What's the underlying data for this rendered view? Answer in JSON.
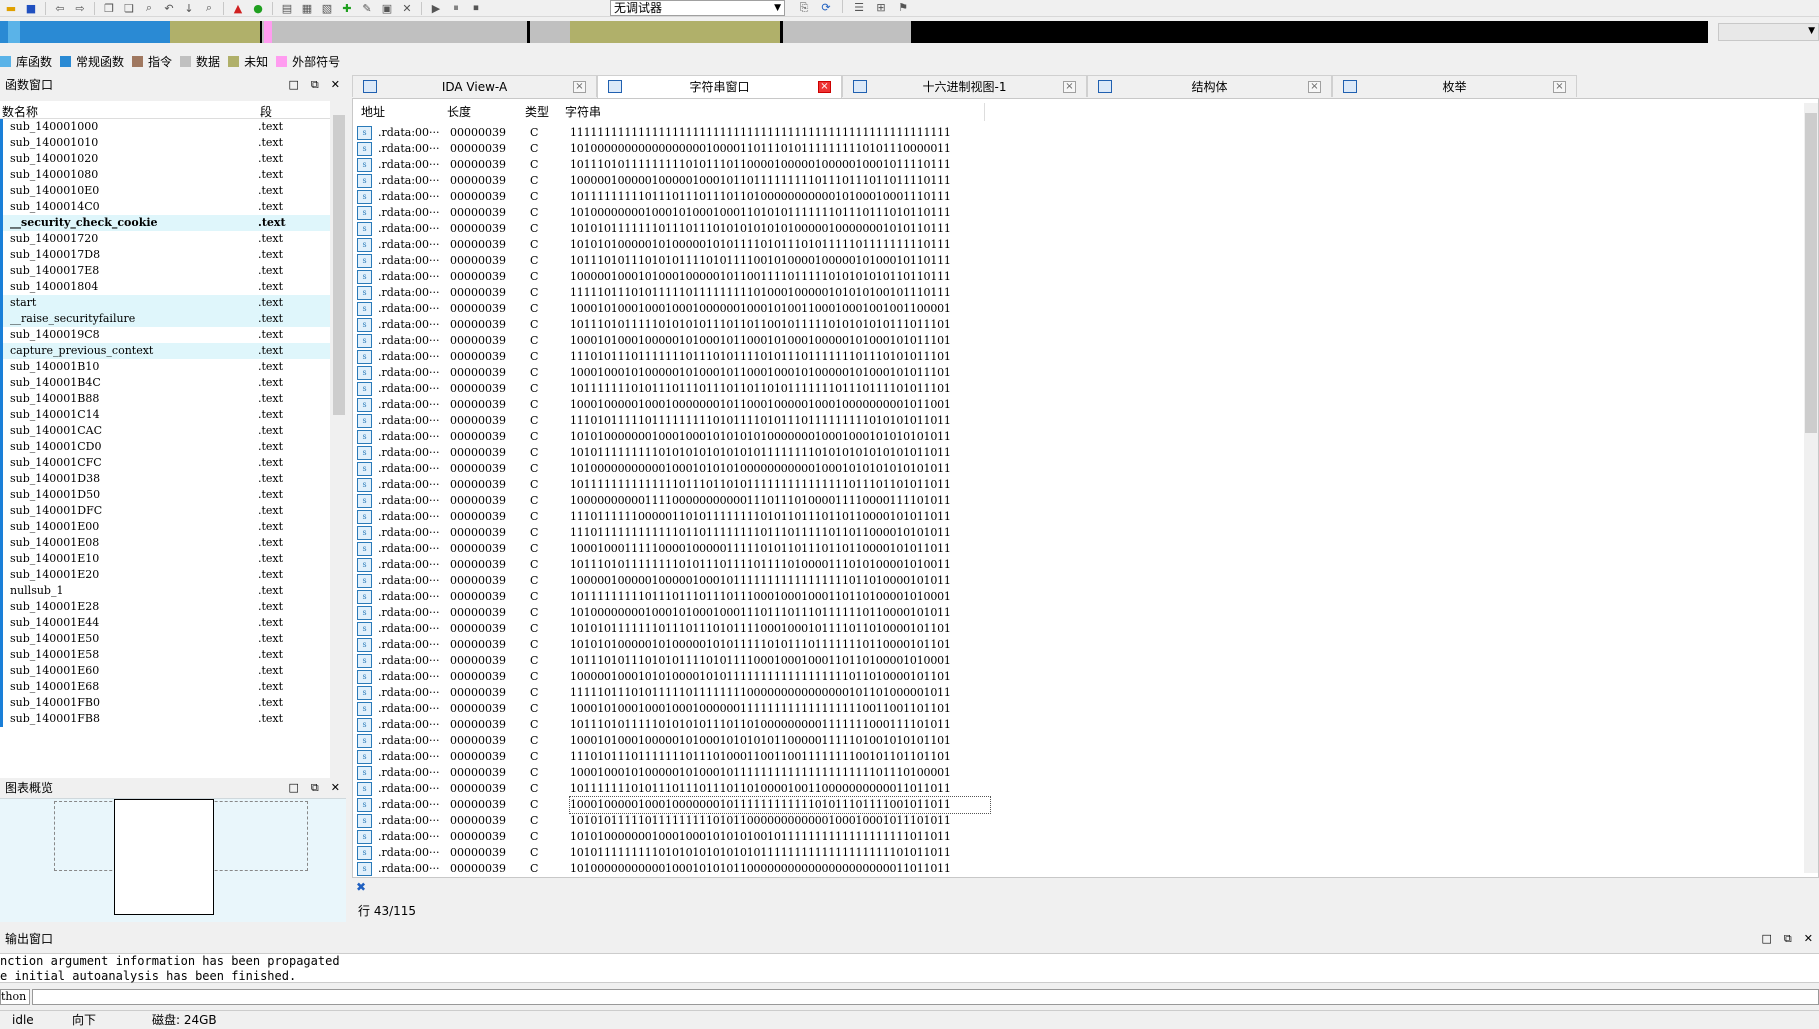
{
  "toolbar": {
    "debugger": "无调试器"
  },
  "legend": [
    {
      "label": "库函数",
      "color": "#5ab3e8"
    },
    {
      "label": "常规函数",
      "color": "#2a8ad4"
    },
    {
      "label": "指令",
      "color": "#a07860"
    },
    {
      "label": "数据",
      "color": "#c0c0c0"
    },
    {
      "label": "未知",
      "color": "#b0b06a"
    },
    {
      "label": "外部符号",
      "color": "#ff9cf0"
    }
  ],
  "functions_panel": {
    "title": "函数窗口",
    "col_name": "数名称",
    "col_segment": "段",
    "rows": [
      {
        "name": "sub_140001000",
        "seg": ".text"
      },
      {
        "name": "sub_140001010",
        "seg": ".text"
      },
      {
        "name": "sub_140001020",
        "seg": ".text"
      },
      {
        "name": "sub_140001080",
        "seg": ".text"
      },
      {
        "name": "sub_1400010E0",
        "seg": ".text"
      },
      {
        "name": "sub_1400014C0",
        "seg": ".text"
      },
      {
        "name": "__security_check_cookie",
        "seg": ".text",
        "hl": true,
        "bold": true
      },
      {
        "name": "sub_140001720",
        "seg": ".text"
      },
      {
        "name": "sub_1400017D8",
        "seg": ".text"
      },
      {
        "name": "sub_1400017E8",
        "seg": ".text"
      },
      {
        "name": "sub_140001804",
        "seg": ".text"
      },
      {
        "name": "start",
        "seg": ".text",
        "hl": true
      },
      {
        "name": "__raise_securityfailure",
        "seg": ".text",
        "hl": true
      },
      {
        "name": "sub_1400019C8",
        "seg": ".text"
      },
      {
        "name": "capture_previous_context",
        "seg": ".text",
        "hl": true
      },
      {
        "name": "sub_140001B10",
        "seg": ".text"
      },
      {
        "name": "sub_140001B4C",
        "seg": ".text"
      },
      {
        "name": "sub_140001B88",
        "seg": ".text"
      },
      {
        "name": "sub_140001C14",
        "seg": ".text"
      },
      {
        "name": "sub_140001CAC",
        "seg": ".text"
      },
      {
        "name": "sub_140001CD0",
        "seg": ".text"
      },
      {
        "name": "sub_140001CFC",
        "seg": ".text"
      },
      {
        "name": "sub_140001D38",
        "seg": ".text"
      },
      {
        "name": "sub_140001D50",
        "seg": ".text"
      },
      {
        "name": "sub_140001DFC",
        "seg": ".text"
      },
      {
        "name": "sub_140001E00",
        "seg": ".text"
      },
      {
        "name": "sub_140001E08",
        "seg": ".text"
      },
      {
        "name": "sub_140001E10",
        "seg": ".text"
      },
      {
        "name": "sub_140001E20",
        "seg": ".text"
      },
      {
        "name": "nullsub_1",
        "seg": ".text"
      },
      {
        "name": "sub_140001E28",
        "seg": ".text"
      },
      {
        "name": "sub_140001E44",
        "seg": ".text"
      },
      {
        "name": "sub_140001E50",
        "seg": ".text"
      },
      {
        "name": "sub_140001E58",
        "seg": ".text"
      },
      {
        "name": "sub_140001E60",
        "seg": ".text"
      },
      {
        "name": "sub_140001E68",
        "seg": ".text"
      },
      {
        "name": "sub_140001FB0",
        "seg": ".text"
      },
      {
        "name": "sub_140001FB8",
        "seg": ".text"
      }
    ]
  },
  "graph_overview": {
    "title": "图表概览"
  },
  "tabs": [
    {
      "label": "IDA View-A"
    },
    {
      "label": "字符串窗口",
      "active": true
    },
    {
      "label": "十六进制视图-1"
    },
    {
      "label": "结构体"
    },
    {
      "label": "枚举"
    }
  ],
  "strings": {
    "headers": {
      "addr": "地址",
      "len": "长度",
      "type": "类型",
      "str": "字符串"
    },
    "rows": [
      {
        "addr": ".rdata:00···",
        "len": "00000039",
        "type": "C",
        "str": "11111111111111111111111111111111111111111111111111111111"
      },
      {
        "addr": ".rdata:00···",
        "len": "00000039",
        "type": "C",
        "str": "10100000000000000000100001101110101111111110101110000011"
      },
      {
        "addr": ".rdata:00···",
        "len": "00000039",
        "type": "C",
        "str": "10111010111111111010111011000010000010000010001011110111"
      },
      {
        "addr": ".rdata:00···",
        "len": "00000039",
        "type": "C",
        "str": "10000010000010000010001011011111111101110111011011110111"
      },
      {
        "addr": ".rdata:00···",
        "len": "00000039",
        "type": "C",
        "str": "10111111111011101110111011010000000000010100010001110111"
      },
      {
        "addr": ".rdata:00···",
        "len": "00000039",
        "type": "C",
        "str": "10100000000100010100010001101010111111101110111010110111"
      },
      {
        "addr": ".rdata:00···",
        "len": "00000039",
        "type": "C",
        "str": "10101011111110111011101010101010100000100000001010110111"
      },
      {
        "addr": ".rdata:00···",
        "len": "00000039",
        "type": "C",
        "str": "10101010000010100000101011110101110101111101111111110111"
      },
      {
        "addr": ".rdata:00···",
        "len": "00000039",
        "type": "C",
        "str": "10111010111010101111010111100101000010000010100010110111"
      },
      {
        "addr": ".rdata:00···",
        "len": "00000039",
        "type": "C",
        "str": "10000010001010001000001011001111011111010101010110110111"
      },
      {
        "addr": ".rdata:00···",
        "len": "00000039",
        "type": "C",
        "str": "11111011101011111011111111101000100000101010100101110111"
      },
      {
        "addr": ".rdata:00···",
        "len": "00000039",
        "type": "C",
        "str": "10001010001000100010000001000101001100010001001001100001"
      },
      {
        "addr": ".rdata:00···",
        "len": "00000039",
        "type": "C",
        "str": "10111010111110101010111011011001011111010101010111011101"
      },
      {
        "addr": ".rdata:00···",
        "len": "00000039",
        "type": "C",
        "str": "10001010001000001010001011000101000100000101000101011101"
      },
      {
        "addr": ".rdata:00···",
        "len": "00000039",
        "type": "C",
        "str": "11101011101111111011101011110101110111111101110101011101"
      },
      {
        "addr": ".rdata:00···",
        "len": "00000039",
        "type": "C",
        "str": "10001000101000001010001011000100010100000101000101011101"
      },
      {
        "addr": ".rdata:00···",
        "len": "00000039",
        "type": "C",
        "str": "10111111101011101110111011011010111111101110111101011101"
      },
      {
        "addr": ".rdata:00···",
        "len": "00000039",
        "type": "C",
        "str": "10001000001000100000001011000100000100010000000001011001"
      },
      {
        "addr": ".rdata:00···",
        "len": "00000039",
        "type": "C",
        "str": "11101011111011111111101011110101110111111111010101011011"
      },
      {
        "addr": ".rdata:00···",
        "len": "00000039",
        "type": "C",
        "str": "10101000000010001000101010101000000010001000101010101011"
      },
      {
        "addr": ".rdata:00···",
        "len": "00000039",
        "type": "C",
        "str": "10101111111110101010101010101111111101010101010101011011"
      },
      {
        "addr": ".rdata:00···",
        "len": "00000039",
        "type": "C",
        "str": "10100000000000100010101010000000000010001010101010101011"
      },
      {
        "addr": ".rdata:00···",
        "len": "00000039",
        "type": "C",
        "str": "10111111111111110111011010111111111111111011101101011011"
      },
      {
        "addr": ".rdata:00···",
        "len": "00000039",
        "type": "C",
        "str": "10000000000111100000000000111011101000011110000111101011"
      },
      {
        "addr": ".rdata:00···",
        "len": "00000039",
        "type": "C",
        "str": "11101111110000011010111111110101101110110110000101011011"
      },
      {
        "addr": ".rdata:00···",
        "len": "00000039",
        "type": "C",
        "str": "11101111111111110110111111110111011111011011000010101011"
      },
      {
        "addr": ".rdata:00···",
        "len": "00000039",
        "type": "C",
        "str": "10001000111110000100000111110101101110110110000101011011"
      },
      {
        "addr": ".rdata:00···",
        "len": "00000039",
        "type": "C",
        "str": "10111010111111110101110111101111010000111010100001010011"
      },
      {
        "addr": ".rdata:00···",
        "len": "00000039",
        "type": "C",
        "str": "10000010000010000010001011111111111111111011010000101011"
      },
      {
        "addr": ".rdata:00···",
        "len": "00000039",
        "type": "C",
        "str": "10111111111011101110111011100010001000110110100001010001"
      },
      {
        "addr": ".rdata:00···",
        "len": "00000039",
        "type": "C",
        "str": "10100000000100010100010001110111011101111110110000101011"
      },
      {
        "addr": ".rdata:00···",
        "len": "00000039",
        "type": "C",
        "str": "10101011111110111011101011110001000101111011010000101101"
      },
      {
        "addr": ".rdata:00···",
        "len": "00000039",
        "type": "C",
        "str": "10101010000010100000101011111010111011111110110000101101"
      },
      {
        "addr": ".rdata:00···",
        "len": "00000039",
        "type": "C",
        "str": "10111010111010101111010111100010001000110110100001010001"
      },
      {
        "addr": ".rdata:00···",
        "len": "00000039",
        "type": "C",
        "str": "10000010001010100001010111111111111111111011010000101101"
      },
      {
        "addr": ".rdata:00···",
        "len": "00000039",
        "type": "C",
        "str": "11111011101011111011111111000000000000000101101000001011"
      },
      {
        "addr": ".rdata:00···",
        "len": "00000039",
        "type": "C",
        "str": "10001010001000100010000001111111111111111110011001101101"
      },
      {
        "addr": ".rdata:00···",
        "len": "00000039",
        "type": "C",
        "str": "10111010111110101010111011010000000001111111000111101011"
      },
      {
        "addr": ".rdata:00···",
        "len": "00000039",
        "type": "C",
        "str": "10001010001000001010001010101011000001111101001010101101"
      },
      {
        "addr": ".rdata:00···",
        "len": "00000039",
        "type": "C",
        "str": "11101011101111111011101000110011001111111100101101101101"
      },
      {
        "addr": ".rdata:00···",
        "len": "00000039",
        "type": "C",
        "str": "10001000101000001010001011111111111111111111101110100001"
      },
      {
        "addr": ".rdata:00···",
        "len": "00000039",
        "type": "C",
        "str": "10111111101011101110111011010000100110000000000011011011"
      },
      {
        "addr": ".rdata:00···",
        "len": "00000039",
        "type": "C",
        "str": "10001000001000100000001011111111111101011101111001011011",
        "sel": true
      },
      {
        "addr": ".rdata:00···",
        "len": "00000039",
        "type": "C",
        "str": "10101011111011111111101011000000000000100010001011101011"
      },
      {
        "addr": ".rdata:00···",
        "len": "00000039",
        "type": "C",
        "str": "10101000000010001000101010100101111111111111111111011011"
      },
      {
        "addr": ".rdata:00···",
        "len": "00000039",
        "type": "C",
        "str": "10101111111110101010101010101111111111111111111101011011"
      },
      {
        "addr": ".rdata:00···",
        "len": "00000039",
        "type": "C",
        "str": "10100000000000100010101011000000000000000000000011011011"
      }
    ]
  },
  "row_status": "行 43/115",
  "output": {
    "title": "输出窗口",
    "lines": [
      "nction argument information has been propagated",
      "e initial autoanalysis has been finished."
    ],
    "lang": "thon"
  },
  "statusbar": {
    "state": "idle",
    "direction": "向下",
    "disk": "磁盘: 24GB"
  }
}
